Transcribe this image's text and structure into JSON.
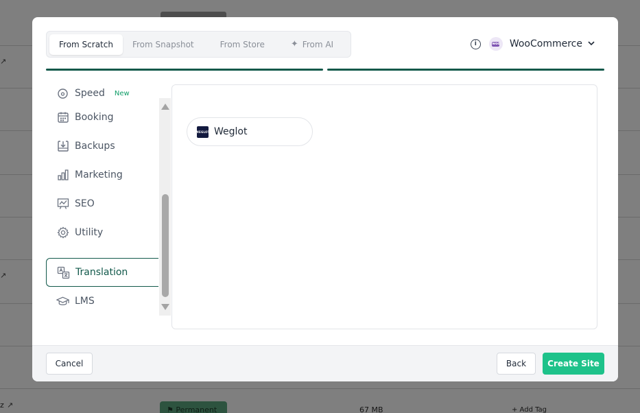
{
  "modal": {
    "tabs": [
      {
        "label": "From Scratch",
        "active": true
      },
      {
        "label": "From Snapshot",
        "active": false
      },
      {
        "label": "From Store",
        "active": false
      },
      {
        "label": "From AI",
        "active": false,
        "icon": "sparkle-icon"
      }
    ],
    "platform": {
      "label": "WooCommerce",
      "logo": "woocommerce-logo"
    },
    "categories": [
      {
        "label": "Speed",
        "icon": "speed-gauge-icon",
        "badge": "New"
      },
      {
        "label": "Booking",
        "icon": "calendar-icon"
      },
      {
        "label": "Backups",
        "icon": "backup-download-icon"
      },
      {
        "label": "Marketing",
        "icon": "bar-chart-icon"
      },
      {
        "label": "SEO",
        "icon": "presentation-chart-icon"
      },
      {
        "label": "Utility",
        "icon": "gear-icon"
      },
      {
        "label": "Translation",
        "icon": "translate-icon",
        "active": true
      },
      {
        "label": "LMS",
        "icon": "graduation-cap-icon"
      }
    ],
    "plugins": [
      {
        "name": "Weglot",
        "logo_text": "WEGLOT"
      }
    ],
    "footer": {
      "cancel_label": "Cancel",
      "back_label": "Back",
      "create_label": "Create Site"
    }
  },
  "background": {
    "badge_label": "Permanent",
    "size_label": "67 MB",
    "add_tag_label": "+ Add Tag",
    "row_fragment": "z"
  },
  "colors": {
    "accent": "#11584a",
    "primary_button": "#1ec28a",
    "new_badge": "#0f9d67"
  }
}
